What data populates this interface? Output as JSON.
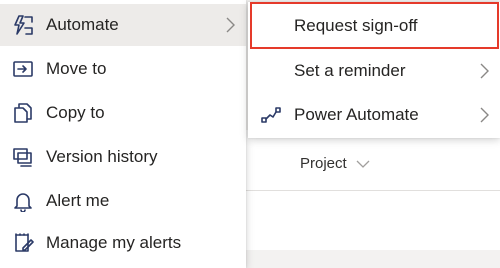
{
  "main_menu": {
    "items": [
      {
        "label": "Automate",
        "icon": "automate-icon",
        "has_submenu": true
      },
      {
        "label": "Move to",
        "icon": "move-to-icon"
      },
      {
        "label": "Copy to",
        "icon": "copy-icon"
      },
      {
        "label": "Version history",
        "icon": "version-history-icon"
      },
      {
        "label": "Alert me",
        "icon": "bell-icon"
      },
      {
        "label": "Manage my alerts",
        "icon": "manage-alerts-icon"
      }
    ]
  },
  "submenu": {
    "items": [
      {
        "label": "Request sign-off",
        "highlighted": true
      },
      {
        "label": "Set a reminder",
        "has_submenu": true
      },
      {
        "label": "Power Automate",
        "icon": "power-automate-icon",
        "has_submenu": true
      }
    ]
  },
  "column_header": {
    "label": "Project"
  },
  "colors": {
    "highlight_border": "#e53a2a",
    "icon_color": "#2b3a67",
    "hover_bg": "#edebe9"
  }
}
